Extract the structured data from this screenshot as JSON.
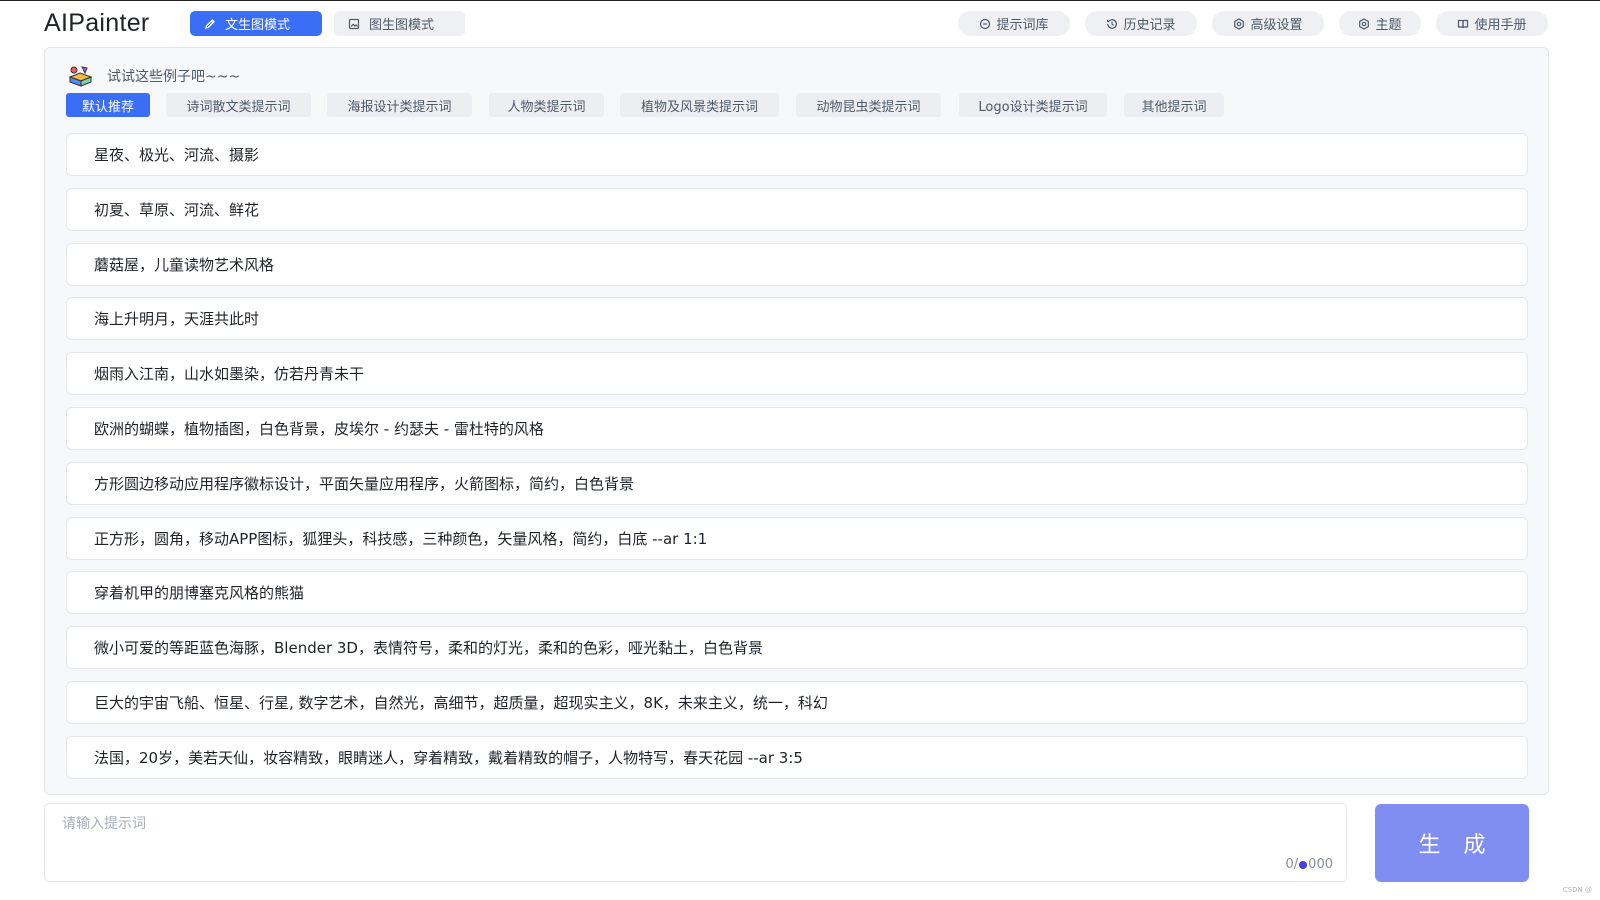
{
  "header": {
    "logo": "AIPainter",
    "modes": [
      {
        "label": "文生图模式",
        "active": true,
        "icon": "pencil-icon"
      },
      {
        "label": "图生图模式",
        "active": false,
        "icon": "image-icon"
      }
    ],
    "nav": [
      {
        "label": "提示词库",
        "icon": "prompt-library-icon"
      },
      {
        "label": "历史记录",
        "icon": "history-icon"
      },
      {
        "label": "高级设置",
        "icon": "settings-icon"
      },
      {
        "label": "主题",
        "icon": "gear-icon"
      },
      {
        "label": "使用手册",
        "icon": "book-icon"
      }
    ]
  },
  "examples": {
    "hint_icon": "palette-icon",
    "hint": "试试这些例子吧~~~",
    "categories": [
      {
        "label": "默认推荐",
        "active": true
      },
      {
        "label": "诗词散文类提示词",
        "active": false
      },
      {
        "label": "海报设计类提示词",
        "active": false
      },
      {
        "label": "人物类提示词",
        "active": false
      },
      {
        "label": "植物及风景类提示词",
        "active": false
      },
      {
        "label": "动物昆虫类提示词",
        "active": false
      },
      {
        "label": "Logo设计类提示词",
        "active": false
      },
      {
        "label": "其他提示词",
        "active": false
      }
    ],
    "items": [
      "星夜、极光、河流、摄影",
      "初夏、草原、河流、鲜花",
      "蘑菇屋，儿童读物艺术风格",
      "海上升明月，天涯共此时",
      "烟雨入江南，山水如墨染，仿若丹青未干",
      "欧洲的蝴蝶，植物插图，白色背景，皮埃尔 - 约瑟夫 - 雷杜特的风格",
      "方形圆边移动应用程序徽标设计，平面矢量应用程序，火箭图标，简约，白色背景",
      "正方形，圆角，移动APP图标，狐狸头，科技感，三种颜色，矢量风格，简约，白底 --ar 1:1",
      "穿着机甲的朋博塞克风格的熊猫",
      "微小可爱的等距蓝色海豚，Blender 3D，表情符号，柔和的灯光，柔和的色彩，哑光黏土，白色背景",
      "巨大的宇宙飞船、恒星、行星, 数字艺术，自然光，高细节，超质量，超现实主义，8K，未来主义，统一，科幻",
      "法国，20岁，美若天仙，妆容精致，眼睛迷人，穿着精致，戴着精致的帽子，人物特写，春天花园 --ar 3:5"
    ]
  },
  "input": {
    "placeholder": "请输入提示词",
    "value": "",
    "counter_left": "0/",
    "counter_right": "000"
  },
  "generate_label": "生 成",
  "watermark": "CSDN @",
  "colors": {
    "accent": "#3b6ef6",
    "generate": "#7f8ef0"
  }
}
